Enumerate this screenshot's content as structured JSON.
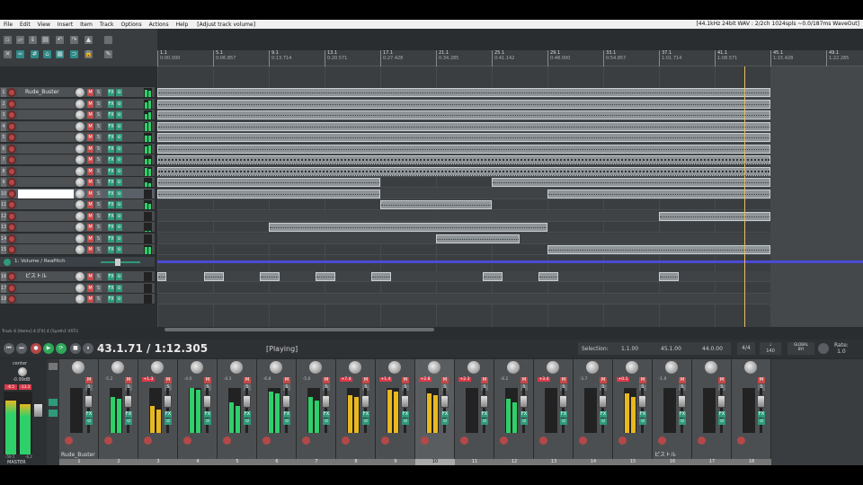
{
  "menu": {
    "items": [
      "File",
      "Edit",
      "View",
      "Insert",
      "Item",
      "Track",
      "Options",
      "Actions",
      "Help"
    ],
    "action_title": "[Adjust track volume]",
    "status": "[44.1kHz 24bit WAV : 2/2ch 1024spls ~0.0/187ms WaveOut]"
  },
  "ruler": {
    "ticks": [
      {
        "bar": "1.1",
        "time": "0:00.000"
      },
      {
        "bar": "5.1",
        "time": "0:06.857"
      },
      {
        "bar": "9.1",
        "time": "0:13.714"
      },
      {
        "bar": "13.1",
        "time": "0:20.571"
      },
      {
        "bar": "17.1",
        "time": "0:27.428"
      },
      {
        "bar": "21.1",
        "time": "0:34.285"
      },
      {
        "bar": "25.1",
        "time": "0:41.142"
      },
      {
        "bar": "29.1",
        "time": "0:48.000"
      },
      {
        "bar": "33.1",
        "time": "0:54.857"
      },
      {
        "bar": "37.1",
        "time": "1:01.714"
      },
      {
        "bar": "41.1",
        "time": "1:08.571"
      },
      {
        "bar": "45.1",
        "time": "1:15.428"
      },
      {
        "bar": "49.1",
        "time": "1:22.285"
      }
    ]
  },
  "tracks": [
    {
      "num": "1",
      "name": "Rude_Buster"
    },
    {
      "num": "2",
      "name": ""
    },
    {
      "num": "3",
      "name": ""
    },
    {
      "num": "4",
      "name": ""
    },
    {
      "num": "5",
      "name": ""
    },
    {
      "num": "6",
      "name": ""
    },
    {
      "num": "7",
      "name": ""
    },
    {
      "num": "8",
      "name": ""
    },
    {
      "num": "9",
      "name": ""
    },
    {
      "num": "10",
      "name": ""
    },
    {
      "num": "11",
      "name": ""
    },
    {
      "num": "12",
      "name": ""
    },
    {
      "num": "13",
      "name": ""
    },
    {
      "num": "14",
      "name": ""
    },
    {
      "num": "15",
      "name": ""
    },
    {
      "num": "16",
      "name": "ピストル"
    },
    {
      "num": "17",
      "name": ""
    },
    {
      "num": "18",
      "name": ""
    }
  ],
  "envelope_lane": {
    "label": "1: Volume / ReaPitch"
  },
  "buttons": {
    "mute": "M",
    "solo": "S",
    "fx": "FX",
    "io": "⊙"
  },
  "status_line": "Track 6 [Items] 4 [FX] 4 [Synth1 VSTi]",
  "transport": {
    "time": "43.1.71 / 1:12.305",
    "state": "[Playing]",
    "selection_label": "Selection:",
    "sel_start": "1.1.00",
    "sel_end": "45.1.00",
    "sel_len": "44.0.00",
    "time_sig": "4/4",
    "bpm_label": "♩",
    "bpm": "140",
    "global_label": "GLOBAL",
    "global_sub": "BYI",
    "rate_label": "Rate:",
    "rate": "1.0"
  },
  "master": {
    "pan": "center",
    "vol": "-0.99dB",
    "peakL": "-6.5",
    "peakR": "-13.3",
    "label": "MASTER",
    "rms": "-59.5",
    "rms2": "-6.2"
  },
  "mixer": {
    "strips": [
      {
        "num": "1",
        "name": "Rude_Buster",
        "val": "",
        "red": false
      },
      {
        "num": "2",
        "name": "",
        "val": "-5.2",
        "red": false
      },
      {
        "num": "3",
        "name": "",
        "val": "+1.3",
        "red": true
      },
      {
        "num": "4",
        "name": "",
        "val": "-4.0",
        "red": false
      },
      {
        "num": "5",
        "name": "",
        "val": "-4.3",
        "red": false
      },
      {
        "num": "6",
        "name": "",
        "val": "-6.8",
        "red": false
      },
      {
        "num": "7",
        "name": "",
        "val": "-5.0",
        "red": false
      },
      {
        "num": "8",
        "name": "",
        "val": "+7.4",
        "red": true
      },
      {
        "num": "9",
        "name": "",
        "val": "+1.4",
        "red": true
      },
      {
        "num": "10",
        "name": "",
        "val": "+2.8",
        "red": true
      },
      {
        "num": "11",
        "name": "",
        "val": "+2.3",
        "red": true
      },
      {
        "num": "12",
        "name": "",
        "val": "-6.2",
        "red": false
      },
      {
        "num": "13",
        "name": "",
        "val": "+3.4",
        "red": true
      },
      {
        "num": "14",
        "name": "",
        "val": "-3.7",
        "red": false
      },
      {
        "num": "15",
        "name": "",
        "val": "+0.1",
        "red": true
      },
      {
        "num": "16",
        "name": "ピストル",
        "val": "-1.9",
        "red": false
      },
      {
        "num": "17",
        "name": "",
        "val": "",
        "red": false
      },
      {
        "num": "18",
        "name": "",
        "val": "",
        "red": false
      }
    ]
  },
  "colors": {
    "accent": "#2e9a7a",
    "mute": "#c34a4a",
    "playhead": "#e2c061",
    "envelope": "#4b4ad6",
    "meter": "#2ed06a",
    "meter_hot": "#e8b81f"
  }
}
